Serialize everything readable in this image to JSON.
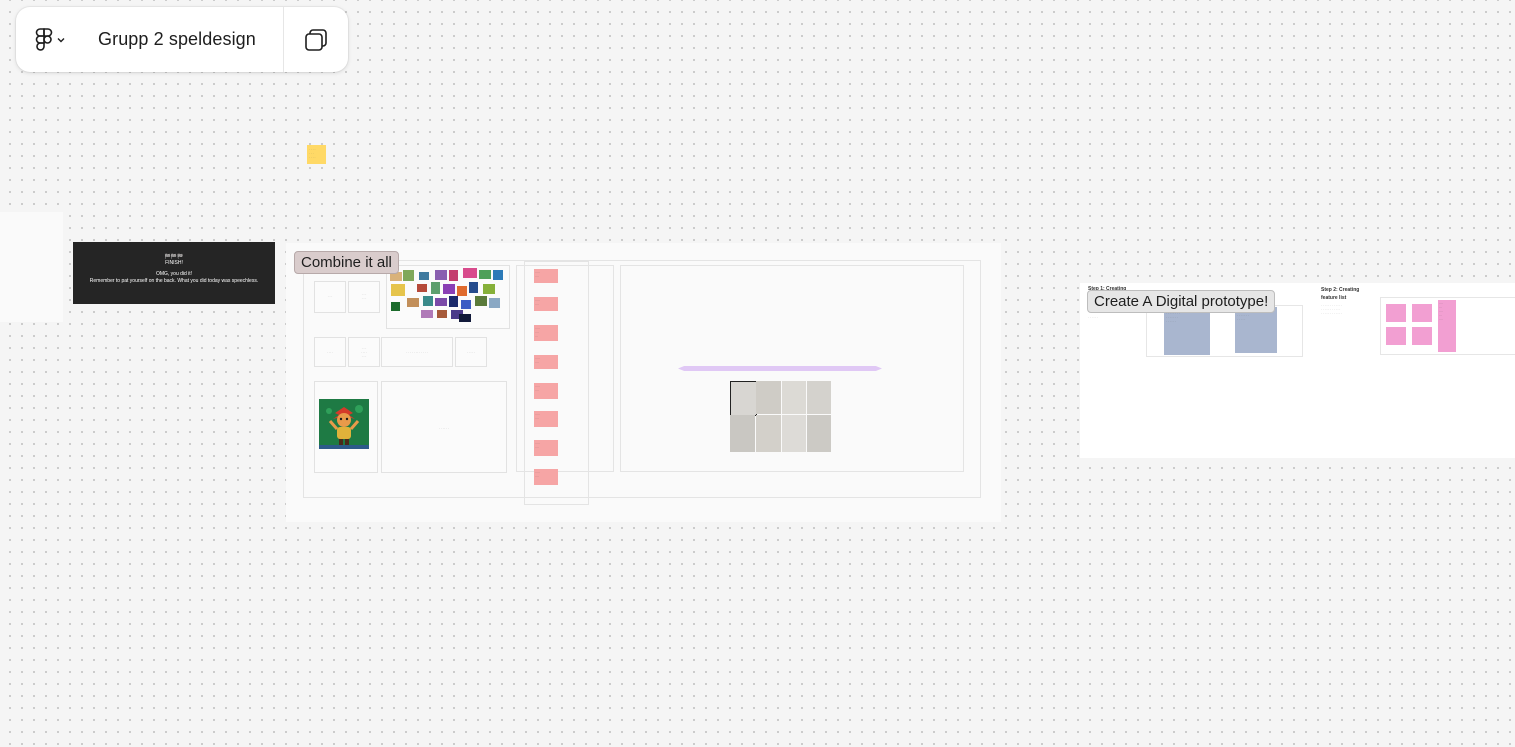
{
  "toolbar": {
    "file_name": "Grupp 2 speldesign",
    "logo_icon": "figma-logo-icon",
    "menu_icon": "chevron-down-icon",
    "pages_icon": "pages-panel-icon"
  },
  "finish_card": {
    "flags": "🏁🏁🏁",
    "title": "FINISH!",
    "line1": "OMG, you did it!",
    "line2": "Remember to pat yourself on the back. What you did today was speechless."
  },
  "sections": {
    "combine_label": "Combine it all",
    "prototype_label": "Create A Digital prototype!",
    "step1_heading": "Step 1: Creating",
    "step2_heading": "Step 2: Creating feature list"
  },
  "colors": {
    "canvas": "#f5f5f5",
    "sticky_yellow": "#ffd966",
    "sticky_pink": "#f6a5a5",
    "sticky_magenta": "#f29fd2",
    "sticky_blue": "#a9b6cf",
    "finish_bg": "#252525"
  }
}
